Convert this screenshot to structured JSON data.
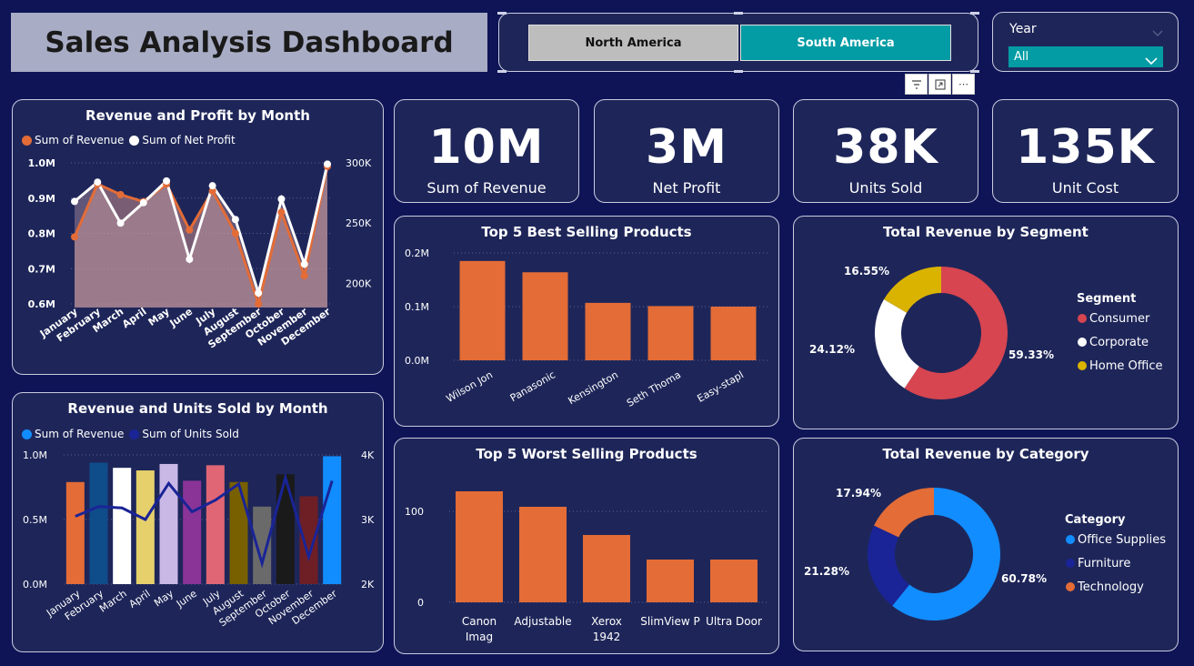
{
  "header": {
    "title": "Sales Analysis Dashboard"
  },
  "region_slicer": {
    "options": [
      "North America",
      "South America"
    ],
    "selected": "South America"
  },
  "year_slicer": {
    "label": "Year",
    "value": "All"
  },
  "toolbar": {
    "icons": [
      "filter-icon",
      "focus-mode-icon",
      "more-options-icon"
    ]
  },
  "kpis": [
    {
      "value": "10M",
      "label": "Sum of Revenue"
    },
    {
      "value": "3M",
      "label": "Net Profit"
    },
    {
      "value": "38K",
      "label": "Units Sold"
    },
    {
      "value": "135K",
      "label": "Unit Cost"
    }
  ],
  "colors": {
    "background": "#0e1456",
    "panel": "#1e2659",
    "orange": "#e36c37",
    "teal": "#049ca4",
    "blue": "#118dff",
    "navy": "#1a2496"
  },
  "chart_data": [
    {
      "id": "rev_profit",
      "type": "area",
      "title": "Revenue and Profit by Month",
      "categories": [
        "January",
        "February",
        "March",
        "April",
        "May",
        "June",
        "July",
        "August",
        "September",
        "October",
        "November",
        "December"
      ],
      "series": [
        {
          "name": "Sum of Revenue",
          "axis": "left",
          "color": "#e36c37",
          "values": [
            0.79,
            0.94,
            0.91,
            0.89,
            0.94,
            0.81,
            0.92,
            0.8,
            0.6,
            0.86,
            0.68,
            0.99
          ]
        },
        {
          "name": "Sum of Net Profit",
          "axis": "right",
          "color": "#ffffff",
          "values": [
            268000,
            284000,
            250000,
            267000,
            285000,
            220000,
            281000,
            253000,
            192000,
            270000,
            216000,
            299000
          ]
        }
      ],
      "left_ticks": [
        "1.0M",
        "0.9M",
        "0.8M",
        "0.7M",
        "0.6M"
      ],
      "left_range": [
        0.6,
        1.0
      ],
      "right_ticks": [
        "300K",
        "250K",
        "200K"
      ],
      "right_range": [
        183000,
        300000
      ]
    },
    {
      "id": "rev_units",
      "type": "bar",
      "title": "Revenue and Units Sold by Month",
      "categories": [
        "January",
        "February",
        "March",
        "April",
        "May",
        "June",
        "July",
        "August",
        "September",
        "October",
        "November",
        "December"
      ],
      "series": [
        {
          "name": "Sum of Revenue",
          "axis": "left",
          "color": "#118dff",
          "values": [
            0.79,
            0.94,
            0.9,
            0.88,
            0.93,
            0.8,
            0.92,
            0.79,
            0.6,
            0.85,
            0.68,
            0.99
          ]
        },
        {
          "name": "Sum of Units Sold",
          "axis": "right",
          "color": "#1a2496",
          "values": [
            3050,
            3200,
            3180,
            3000,
            3560,
            3120,
            3300,
            3550,
            2320,
            3650,
            2420,
            3600
          ]
        }
      ],
      "bar_colors": [
        "#e36c37",
        "#0f4c8a",
        "#ffffff",
        "#e6d06c",
        "#c9b8e6",
        "#8a3498",
        "#e06675",
        "#786000",
        "#6a6a6a",
        "#1a1a1a",
        "#6e1f26",
        "#118dff"
      ],
      "left_ticks": [
        "1.0M",
        "0.5M",
        "0.0M"
      ],
      "left_range": [
        0,
        1.0
      ],
      "right_ticks": [
        "4K",
        "3K",
        "2K"
      ],
      "right_range": [
        2000,
        4000
      ]
    },
    {
      "id": "best",
      "type": "bar",
      "title": "Top 5 Best Selling Products",
      "categories": [
        "Wilson Jon",
        "Panasonic",
        "Kensington",
        "Seth Thoma",
        "Easy-stapl"
      ],
      "values": [
        0.185,
        0.164,
        0.107,
        0.101,
        0.1
      ],
      "yticks": [
        "0.2M",
        "0.1M",
        "0.0M"
      ],
      "ylim": [
        0,
        0.2
      ]
    },
    {
      "id": "worst",
      "type": "bar",
      "title": "Top 5 Worst Selling Products",
      "categories": [
        "Canon Imag",
        "Adjustable",
        "Xerox 1942",
        "SlimView P",
        "Ultra Door"
      ],
      "values": [
        122,
        105,
        74,
        47,
        47
      ],
      "yticks": [
        "100",
        "0"
      ],
      "ylim": [
        0,
        140
      ]
    },
    {
      "id": "segment",
      "type": "pie",
      "title": "Total Revenue by Segment",
      "legend_title": "Segment",
      "labels": [
        "Consumer",
        "Corporate",
        "Home Office"
      ],
      "values": [
        59.33,
        24.12,
        16.55
      ],
      "value_labels": [
        "59.33%",
        "24.12%",
        "16.55%"
      ],
      "colors": [
        "#d64550",
        "#ffffff",
        "#d9b300"
      ]
    },
    {
      "id": "category",
      "type": "pie",
      "title": "Total Revenue by Category",
      "legend_title": "Category",
      "labels": [
        "Office Supplies",
        "Furniture",
        "Technology"
      ],
      "values": [
        60.78,
        21.28,
        17.94
      ],
      "value_labels": [
        "60.78%",
        "21.28%",
        "17.94%"
      ],
      "colors": [
        "#118dff",
        "#1a2496",
        "#e36c37"
      ]
    }
  ]
}
